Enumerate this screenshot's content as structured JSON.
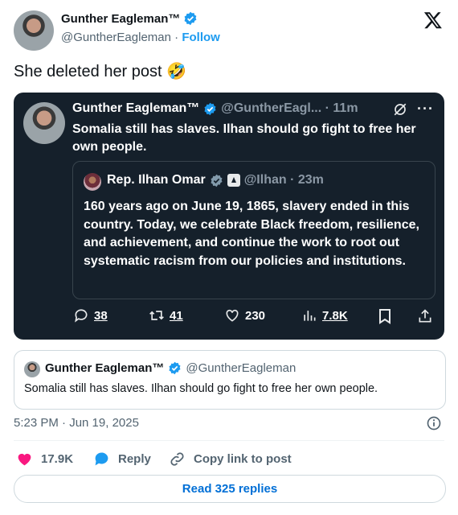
{
  "post": {
    "author_name": "Gunther Eagleman™",
    "handle": "@GuntherEagleman",
    "follow_label": "Follow",
    "text": "She deleted her post",
    "emoji": "🤣",
    "timestamp": "5:23 PM · Jun 19, 2025"
  },
  "embedded": {
    "author_name": "Gunther Eagleman™",
    "handle_time": "@GuntherEagl... · 11m",
    "text": "Somalia still has slaves. Ilhan should go fight to free her own people.",
    "quote": {
      "author_name": "Rep. Ilhan Omar",
      "handle_time": "@Ilhan · 23m",
      "text": "160 years ago on June 19, 1865, slavery ended in this country. Today, we celebrate Black freedom, resilience, and achievement, and continue the work to root out systematic racism from our policies and institutions."
    },
    "stats": {
      "replies": "38",
      "reposts": "41",
      "likes": "230",
      "views": "7.8K"
    }
  },
  "quoted_post": {
    "author_name": "Gunther Eagleman™",
    "handle": "@GuntherEagleman",
    "text": "Somalia still has slaves. Ilhan should go fight to free her own people."
  },
  "actions": {
    "likes": "17.9K",
    "reply_label": "Reply",
    "copy_label": "Copy link to post",
    "read_replies": "Read 325 replies"
  },
  "colors": {
    "accent": "#1d9bf0",
    "like": "#f91880",
    "dark_bg": "#15202b"
  }
}
